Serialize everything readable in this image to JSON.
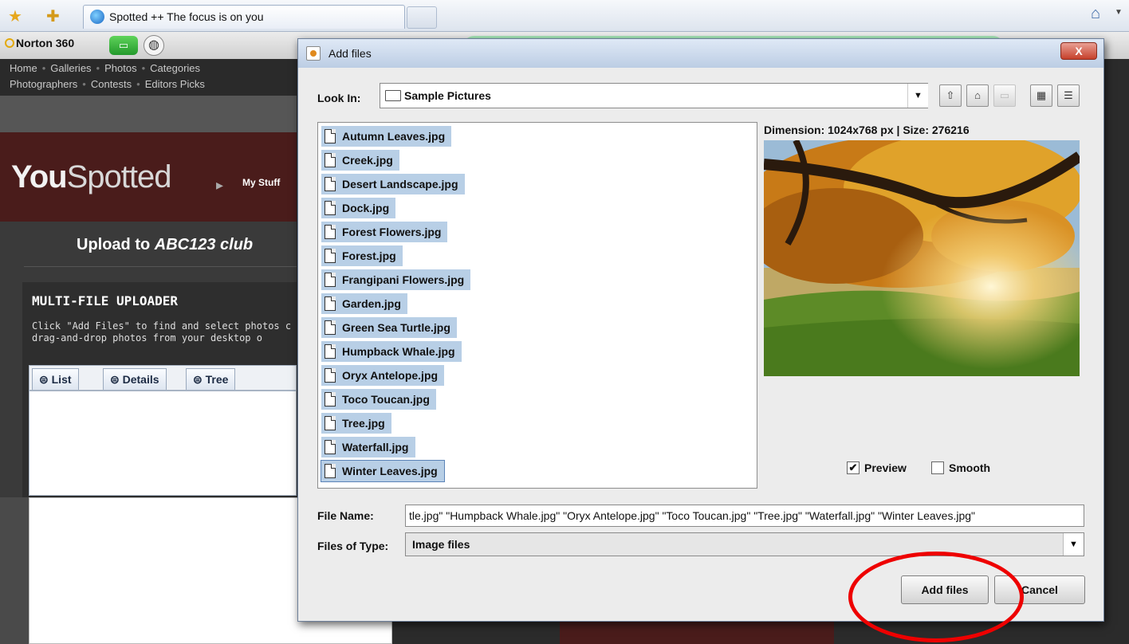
{
  "browser": {
    "tab_title": "Spotted ++ The focus is on you",
    "icons": [
      "favorites-star-icon",
      "add-favorite-icon",
      "ie-icon",
      "home-icon"
    ]
  },
  "norton": {
    "label": "Norton 360"
  },
  "site": {
    "nav_row1": [
      "Home",
      "Galleries",
      "Photos",
      "Categories"
    ],
    "nav_row2": [
      "Photographers",
      "Contests",
      "Editors Picks"
    ],
    "logo_bold": "You",
    "logo_light": "Spotted",
    "my_stuff": "My Stuff",
    "upload_prefix": "Upload to ",
    "upload_club": "ABC123 club",
    "uploader_title": "MULTI-FILE UPLOADER",
    "uploader_desc": "Click \"Add Files\" to find and select photos c\ndrag-and-drop photos from your desktop o",
    "tabs": [
      {
        "label": "List",
        "icon": "list-icon"
      },
      {
        "label": "Details",
        "icon": "details-icon"
      },
      {
        "label": "Tree",
        "icon": "tree-icon"
      }
    ]
  },
  "dialog": {
    "title": "Add files",
    "close_label": "X",
    "look_in_label": "Look In:",
    "look_in_value": "Sample Pictures",
    "toolbar_icons": [
      "up-folder-icon",
      "home-folder-icon",
      "new-folder-icon",
      "list-view-icon",
      "details-view-icon"
    ],
    "files": [
      "Autumn Leaves.jpg",
      "Creek.jpg",
      "Desert Landscape.jpg",
      "Dock.jpg",
      "Forest Flowers.jpg",
      "Forest.jpg",
      "Frangipani Flowers.jpg",
      "Garden.jpg",
      "Green Sea Turtle.jpg",
      "Humpback Whale.jpg",
      "Oryx Antelope.jpg",
      "Toco Toucan.jpg",
      "Tree.jpg",
      "Waterfall.jpg",
      "Winter Leaves.jpg"
    ],
    "dimension_text": "Dimension: 1024x768 px | Size: 276216",
    "preview_label": "Preview",
    "preview_checked": true,
    "smooth_label": "Smooth",
    "smooth_checked": false,
    "file_name_label": "File Name:",
    "file_name_value": "tle.jpg\" \"Humpback Whale.jpg\" \"Oryx Antelope.jpg\" \"Toco Toucan.jpg\" \"Tree.jpg\" \"Waterfall.jpg\" \"Winter Leaves.jpg\"",
    "files_of_type_label": "Files of Type:",
    "files_of_type_value": "Image files",
    "add_files_button": "Add files",
    "cancel_button": "Cancel"
  },
  "colors": {
    "selection": "#b8cfe6",
    "annotation_circle": "#ee0000",
    "site_brand_dark": "#4a1c1b"
  }
}
